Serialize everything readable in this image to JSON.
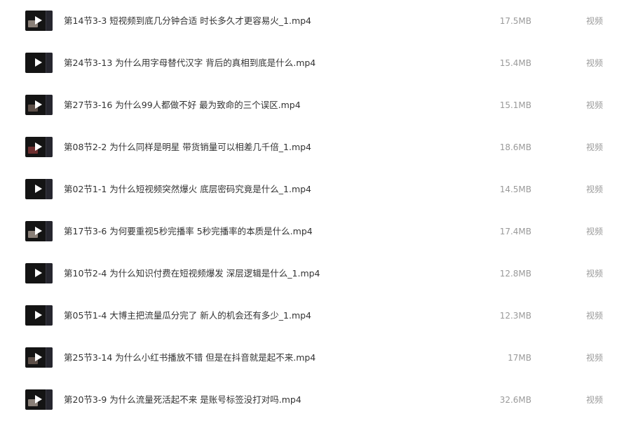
{
  "files": [
    {
      "name": "第14节3-3 短视频到底几分钟合适 时长多久才更容易火_1.mp4",
      "size": "17.5MB",
      "type": "视频",
      "icon": "video-thumbnail-icon"
    },
    {
      "name": "第24节3-13 为什么用字母替代汉字 背后的真相到底是什么.mp4",
      "size": "15.4MB",
      "type": "视频",
      "icon": "video-thumbnail-icon"
    },
    {
      "name": "第27节3-16 为什么99人都做不好 最为致命的三个误区.mp4",
      "size": "15.1MB",
      "type": "视频",
      "icon": "video-thumbnail-icon"
    },
    {
      "name": "第08节2-2 为什么同样是明星 带货销量可以相差几千倍_1.mp4",
      "size": "18.6MB",
      "type": "视频",
      "icon": "video-thumbnail-icon"
    },
    {
      "name": "第02节1-1 为什么短视频突然爆火 底层密码究竟是什么_1.mp4",
      "size": "14.5MB",
      "type": "视频",
      "icon": "video-thumbnail-icon"
    },
    {
      "name": "第17节3-6 为何要重视5秒完播率 5秒完播率的本质是什么.mp4",
      "size": "17.4MB",
      "type": "视频",
      "icon": "video-thumbnail-icon"
    },
    {
      "name": "第10节2-4 为什么知识付费在短视频爆发 深层逻辑是什么_1.mp4",
      "size": "12.8MB",
      "type": "视频",
      "icon": "video-thumbnail-icon"
    },
    {
      "name": "第05节1-4 大博主把流量瓜分完了 新人的机会还有多少_1.mp4",
      "size": "12.3MB",
      "type": "视频",
      "icon": "video-thumbnail-icon"
    },
    {
      "name": "第25节3-14 为什么小红书播放不错 但是在抖音就是起不来.mp4",
      "size": "17MB",
      "type": "视频",
      "icon": "video-thumbnail-icon"
    },
    {
      "name": "第20节3-9 为什么流量死活起不来 是账号标签没打对吗.mp4",
      "size": "32.6MB",
      "type": "视频",
      "icon": "video-thumbnail-icon"
    }
  ]
}
